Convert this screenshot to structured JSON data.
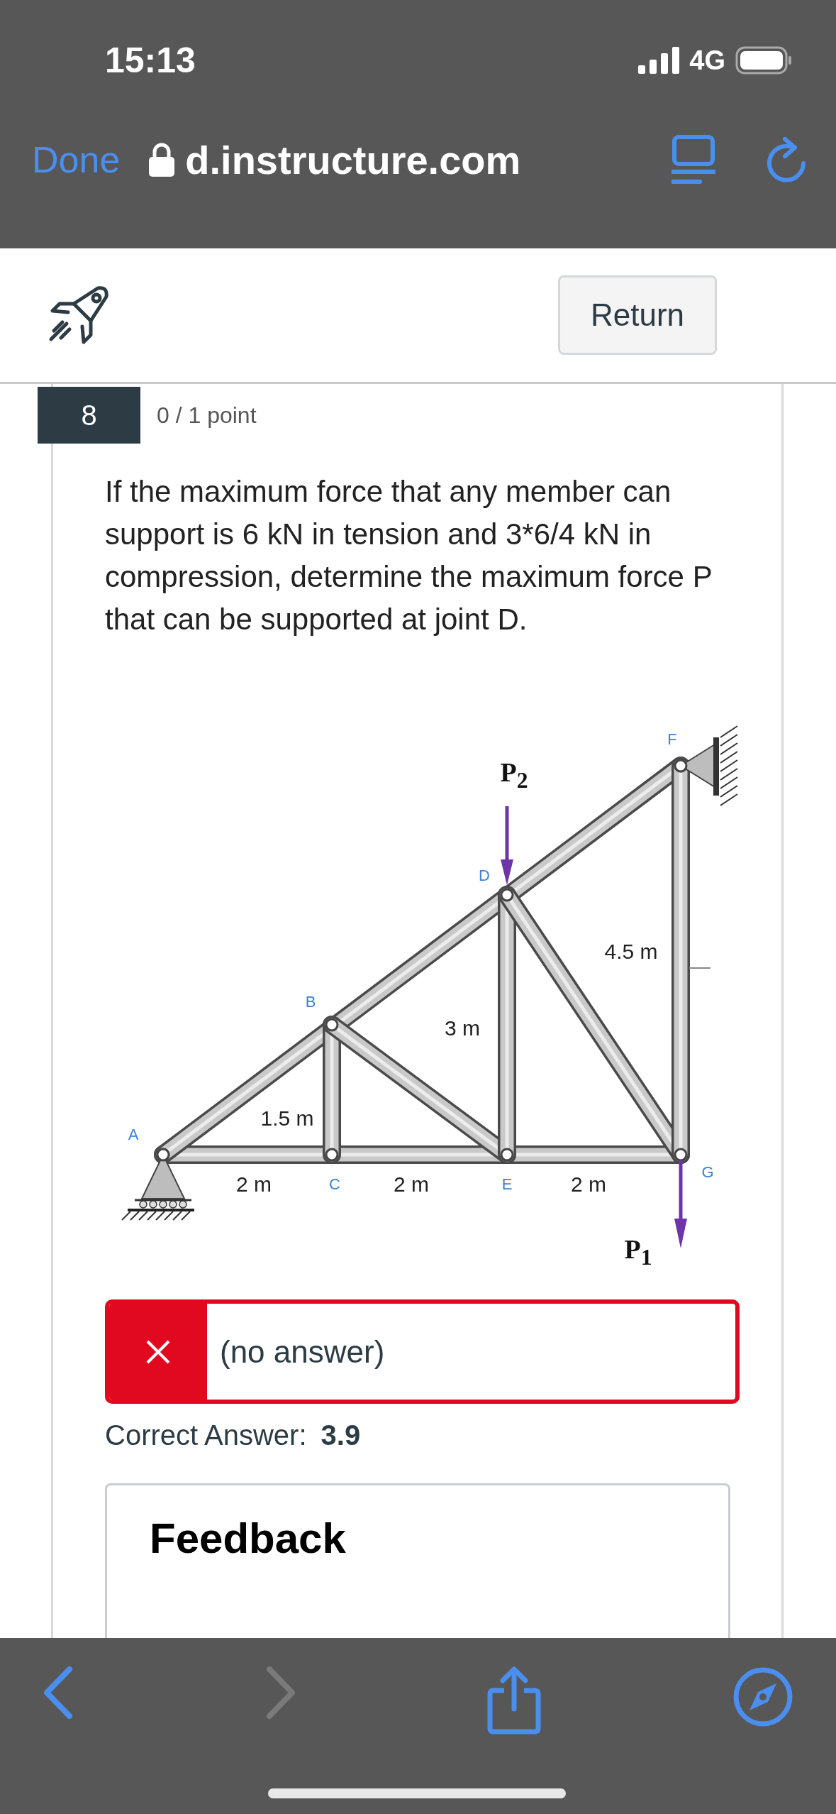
{
  "status_bar": {
    "time": "15:13",
    "network": "4G"
  },
  "browser_bar": {
    "done": "Done",
    "url": "d.instructure.com"
  },
  "header": {
    "return_button": "Return"
  },
  "question": {
    "number": "8",
    "points": "0 / 1 point",
    "text": "If the maximum force that any member can support is 6 kN in tension and 3*6/4 kN in compression, determine the maximum force P that can be supported at joint D.",
    "figure_labels": [
      {
        "kind": "joint",
        "text": "A"
      },
      {
        "kind": "joint",
        "text": "B"
      },
      {
        "kind": "joint",
        "text": "C"
      },
      {
        "kind": "joint",
        "text": "D"
      },
      {
        "kind": "joint",
        "text": "E"
      },
      {
        "kind": "joint",
        "text": "F"
      },
      {
        "kind": "joint",
        "text": "G"
      },
      {
        "kind": "dimension",
        "text": "1.5 m"
      },
      {
        "kind": "dimension",
        "text": "3 m"
      },
      {
        "kind": "dimension",
        "text": "4.5 m"
      },
      {
        "kind": "dimension",
        "text": "2 m"
      },
      {
        "kind": "dimension",
        "text": "2 m"
      },
      {
        "kind": "dimension",
        "text": "2 m"
      },
      {
        "kind": "load",
        "text": "P$_{2}$"
      },
      {
        "kind": "load",
        "text": "P$_{1}$"
      }
    ],
    "answer": {
      "value": "(no answer)",
      "correct": false
    },
    "correct_answer": {
      "label": "Correct Answer:",
      "value": "3.9"
    },
    "feedback": {
      "title": "Feedback"
    }
  },
  "toolbar": {
    "forward_enabled": false
  }
}
